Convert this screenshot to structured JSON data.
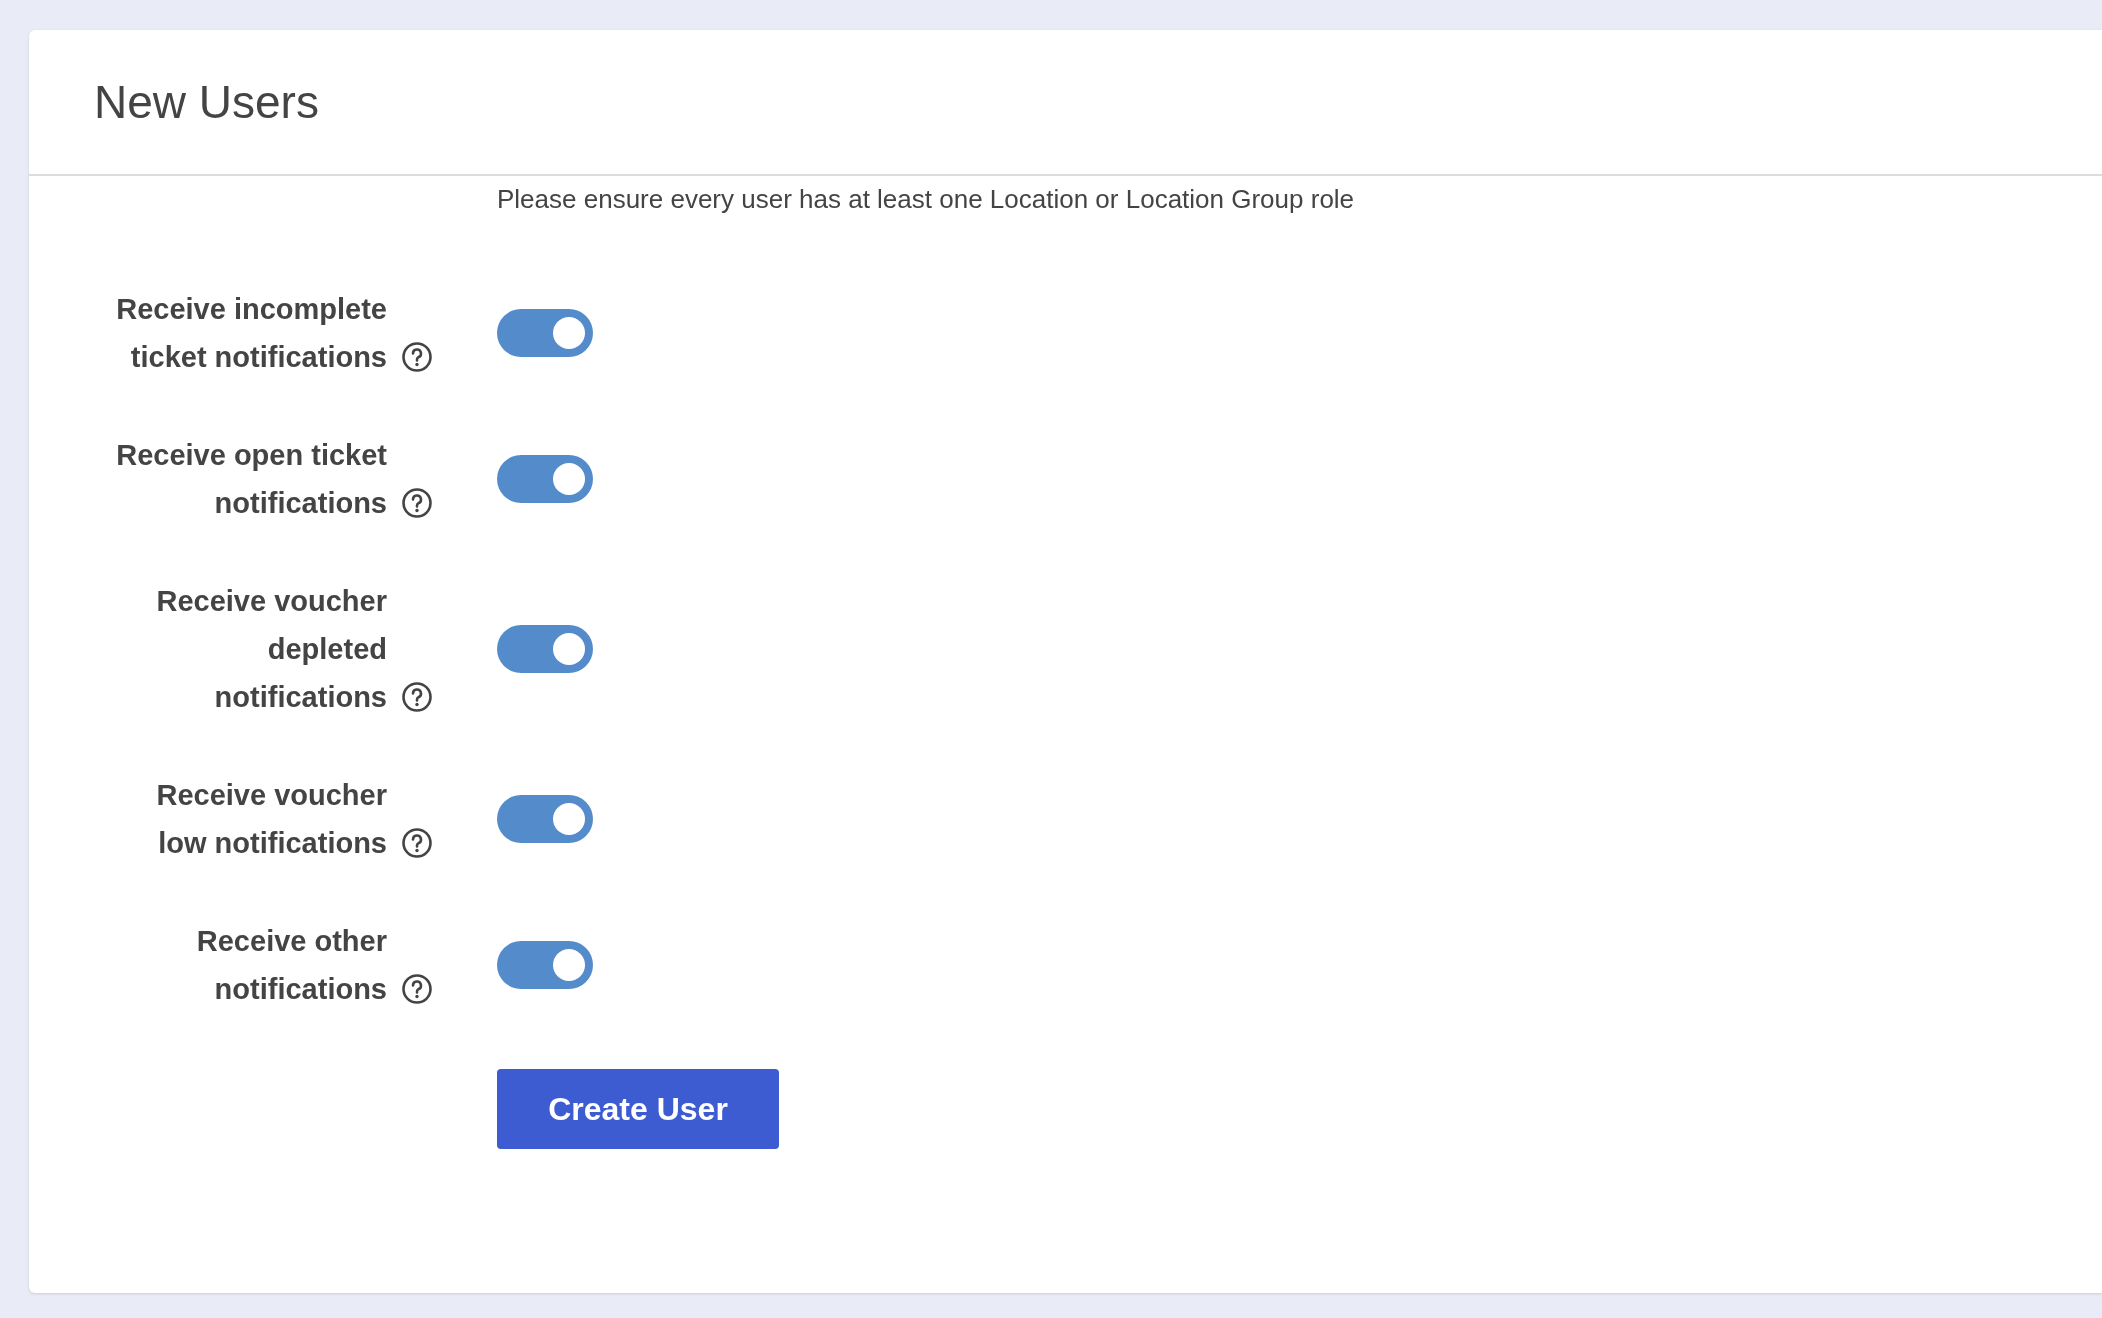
{
  "page": {
    "title": "New Users"
  },
  "notice": "Please ensure every user has at least one Location or Location Group role",
  "settings": [
    {
      "label": "Receive incomplete ticket notifications",
      "on": true
    },
    {
      "label": "Receive open ticket notifications",
      "on": true
    },
    {
      "label": "Receive voucher depleted notifications",
      "on": true
    },
    {
      "label": "Receive voucher low notifications",
      "on": true
    },
    {
      "label": "Receive other notifications",
      "on": true
    }
  ],
  "submit_button": "Create User"
}
